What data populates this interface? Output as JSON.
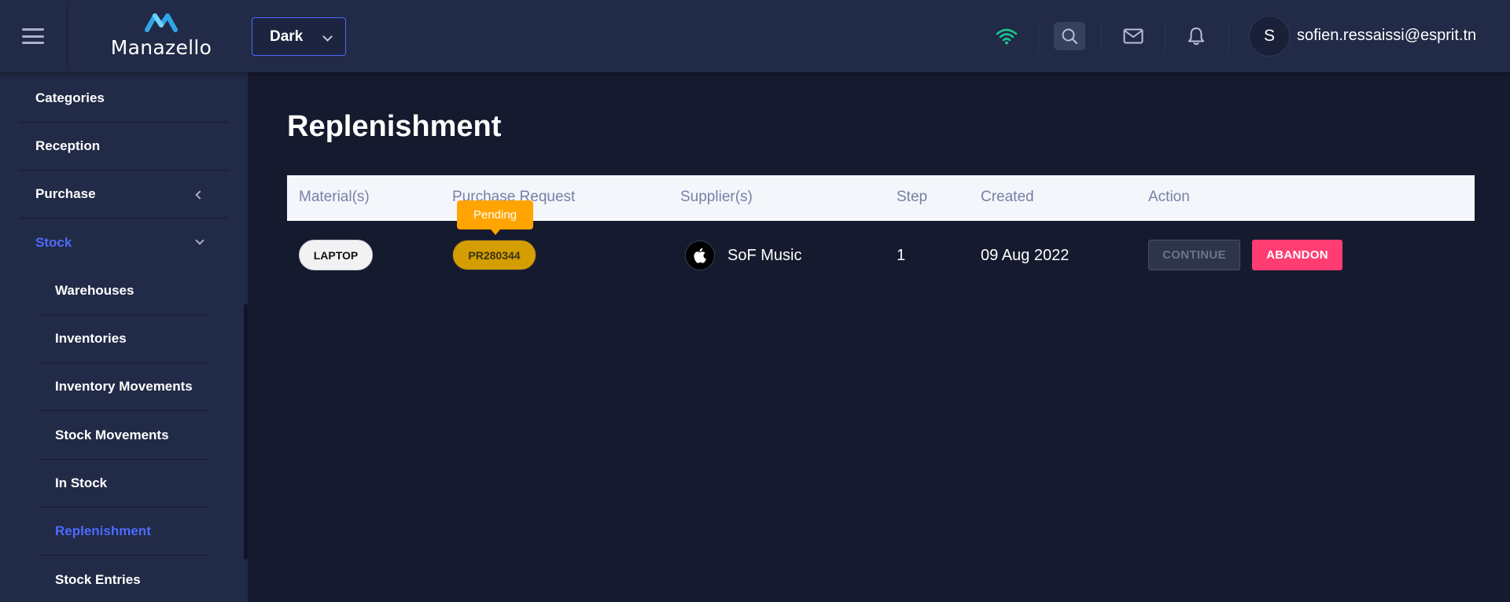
{
  "header": {
    "brand": "Manazello",
    "theme_select": {
      "value": "Dark"
    },
    "user": {
      "avatar_initial": "S",
      "email": "sofien.ressaissi@esprit.tn"
    },
    "icons": [
      "menu-icon",
      "wifi-icon",
      "search-icon",
      "mail-icon",
      "bell-icon"
    ],
    "colors": {
      "wifi": "#1ec28b",
      "accent": "#4d6bfe"
    }
  },
  "sidebar": {
    "items": [
      {
        "label": "Categories"
      },
      {
        "label": "Reception"
      },
      {
        "label": "Purchase",
        "expanded": false
      },
      {
        "label": "Stock",
        "expanded": true,
        "active": true
      }
    ],
    "stock_children": [
      {
        "label": "Warehouses"
      },
      {
        "label": "Inventories"
      },
      {
        "label": "Inventory Movements"
      },
      {
        "label": "Stock Movements"
      },
      {
        "label": "In Stock"
      },
      {
        "label": "Replenishment",
        "active": true
      },
      {
        "label": "Stock Entries"
      }
    ]
  },
  "main": {
    "title": "Replenishment",
    "table": {
      "columns": [
        "Material(s)",
        "Purchase Request",
        "Supplier(s)",
        "Step",
        "Created",
        "Action"
      ],
      "rows": [
        {
          "material": "LAPTOP",
          "purchase_request": "PR280344",
          "status_tooltip": "Pending",
          "supplier": "SoF Music",
          "step": "1",
          "created": "09 Aug 2022",
          "actions": {
            "continue": "CONTINUE",
            "abandon": "ABANDON"
          }
        }
      ]
    },
    "colors": {
      "pending": "#ffa400",
      "abandon": "#ff3d72"
    }
  }
}
